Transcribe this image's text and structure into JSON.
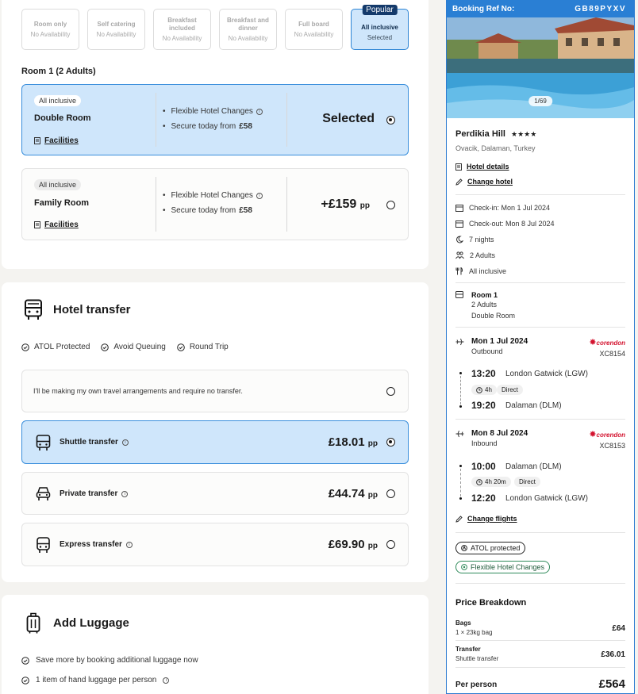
{
  "board": {
    "options": [
      {
        "name": "Room only",
        "availability": "No Availability"
      },
      {
        "name": "Self catering",
        "availability": "No Availability"
      },
      {
        "name": "Breakfast included",
        "availability": "No Availability"
      },
      {
        "name": "Breakfast and dinner",
        "availability": "No Availability"
      },
      {
        "name": "Full board",
        "availability": "No Availability"
      },
      {
        "name": "All inclusive",
        "availability": "Selected",
        "badge": "Popular"
      }
    ]
  },
  "rooms": {
    "heading": "Room 1 (2 Adults)",
    "items": [
      {
        "tag": "All inclusive",
        "name": "Double Room",
        "facilities": "Facilities",
        "feature1": "Flexible Hotel Changes",
        "feature2_prefix": "Secure today from",
        "feature2_amount": "£58",
        "price": "Selected",
        "unit": ""
      },
      {
        "tag": "All inclusive",
        "name": "Family Room",
        "facilities": "Facilities",
        "feature1": "Flexible Hotel Changes",
        "feature2_prefix": "Secure today from",
        "feature2_amount": "£58",
        "price": "+£159",
        "unit": "pp"
      }
    ]
  },
  "transfer": {
    "title": "Hotel transfer",
    "checks": [
      "ATOL Protected",
      "Avoid Queuing",
      "Round Trip"
    ],
    "no_transfer": "I'll be making my own travel arrangements and require no transfer.",
    "options": [
      {
        "label": "Shuttle transfer",
        "price": "£18.01",
        "unit": "pp"
      },
      {
        "label": "Private transfer",
        "price": "£44.74",
        "unit": "pp"
      },
      {
        "label": "Express transfer",
        "price": "£69.90",
        "unit": "pp"
      }
    ]
  },
  "luggage": {
    "title": "Add Luggage",
    "items": [
      "Save more by booking additional luggage now",
      "1 item of hand luggage per person"
    ]
  },
  "sidebar": {
    "ref_label": "Booking Ref No:",
    "ref": "GB89PYXV",
    "photo_count": "1/69",
    "hotel_name": "Perdikia Hill",
    "stars": "★★★★",
    "location": "Ovacik, Dalaman, Turkey",
    "hotel_details": "Hotel details",
    "change_hotel": "Change hotel",
    "checkin": "Check-in: Mon 1 Jul 2024",
    "checkout": "Check-out: Mon 8 Jul 2024",
    "nights": "7 nights",
    "guests": "2 Adults",
    "board": "All inclusive",
    "room_title": "Room 1",
    "room_guests": "2 Adults",
    "room_type": "Double Room",
    "outbound": {
      "date": "Mon 1 Jul 2024",
      "dir": "Outbound",
      "airline": "corendon",
      "code": "XC8154",
      "dep_time": "13:20",
      "dep_place": "London Gatwick (LGW)",
      "duration": "4h",
      "stops": "Direct",
      "arr_time": "19:20",
      "arr_place": "Dalaman (DLM)"
    },
    "inbound": {
      "date": "Mon 8 Jul 2024",
      "dir": "Inbound",
      "airline": "corendon",
      "code": "XC8153",
      "dep_time": "10:00",
      "dep_place": "Dalaman (DLM)",
      "duration": "4h 20m",
      "stops": "Direct",
      "arr_time": "12:20",
      "arr_place": "London Gatwick (LGW)"
    },
    "change_flights": "Change flights",
    "atol": "ATOL protected",
    "flex": "Flexible Hotel Changes",
    "price_title": "Price Breakdown",
    "bags_label": "Bags",
    "bags_sub": "1 × 23kg bag",
    "bags_val": "£64",
    "transfer_label": "Transfer",
    "transfer_sub": "Shuttle transfer",
    "transfer_val": "£36.01",
    "per_person_label": "Per person",
    "per_person_val": "£564"
  },
  "colors": {
    "accent": "#2a7fd4",
    "selected_bg": "#cfe6fb",
    "airline": "#d3132f"
  }
}
